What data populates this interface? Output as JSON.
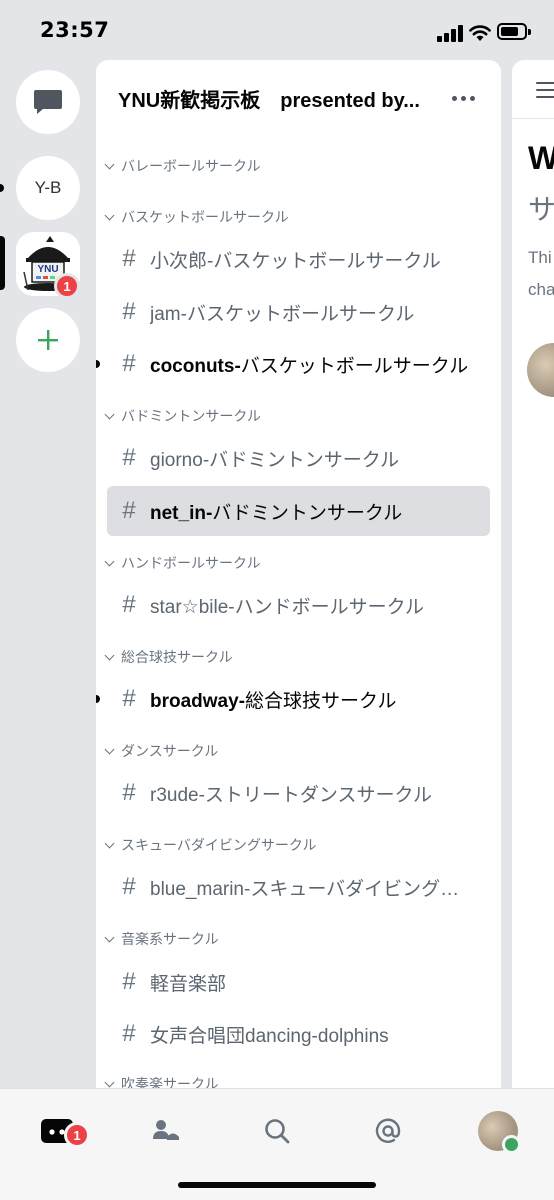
{
  "status_bar": {
    "time": "23:57"
  },
  "rail": {
    "dm_icon": "chat-bubble-icon",
    "server_yb_label": "Y-B",
    "server_ynu_label": "YNU",
    "server_ynu_badge": "1",
    "add_icon": "plus-icon",
    "colors": {
      "add": "#3ba55d",
      "badge": "#ed4245"
    }
  },
  "panel": {
    "server_name": "YNU新歓掲示板　presented by...",
    "categories": [
      {
        "label": "バレーボールサークル"
      },
      {
        "label": "バスケットボールサークル"
      },
      {
        "label": "バドミントンサークル"
      },
      {
        "label": "ハンドボールサークル"
      },
      {
        "label": "総合球技サークル"
      },
      {
        "label": "ダンスサークル"
      },
      {
        "label": "スキューバダイビングサークル"
      },
      {
        "label": "音楽系サークル"
      },
      {
        "label": "吹奏楽サークル"
      }
    ],
    "channels": [
      {
        "hash": "#",
        "name": "小次郎-バスケットボールサークル"
      },
      {
        "hash": "#",
        "name": "jam-バスケットボールサークル"
      },
      {
        "hash": "#",
        "bold": "coconuts-",
        "rest": "バスケットボールサークル"
      },
      {
        "hash": "#",
        "name": "giorno-バドミントンサークル"
      },
      {
        "hash": "#",
        "bold": "net_in-",
        "rest": "バドミントンサークル"
      },
      {
        "hash": "#",
        "name": "star☆bile-ハンドボールサークル"
      },
      {
        "hash": "#",
        "bold": "broadway-",
        "rest": "総合球技サークル"
      },
      {
        "hash": "#",
        "name": "r3ude-ストリートダンスサークル"
      },
      {
        "hash": "#",
        "name": "blue_marin-スキューバダイビング…"
      },
      {
        "hash": "#",
        "name": "軽音楽部"
      },
      {
        "hash": "#",
        "name": "女声合唱団dancing-dolphins"
      }
    ]
  },
  "peek": {
    "title": "W",
    "sub": "サ",
    "text1": "Thi",
    "text2": "cha"
  },
  "tabbar": {
    "home_badge": "1",
    "icons": [
      "discord-home-icon",
      "friends-icon",
      "search-icon",
      "mentions-icon",
      "profile-avatar"
    ]
  }
}
